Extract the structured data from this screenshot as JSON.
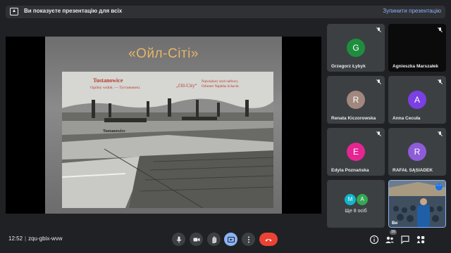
{
  "banner": {
    "message": "Ви показуєте презентацію для всіх",
    "stop_label": "Зупинити презентацію"
  },
  "slide": {
    "title": "«Ойл-Сіті»",
    "photo": {
      "caption_title": "Tustanowice",
      "caption_sub": "Ogólny widok. — Тустановичі.",
      "caption_mid": "„Oil-City“",
      "caption_right_1": "Największy szyb naftowy.",
      "caption_right_2": "Orbester Naphtha Schacht.",
      "caption_label": "Tustanowice"
    }
  },
  "participants": [
    {
      "name": "Grzegorz Łybyk",
      "initial": "G",
      "color": "#1e8e3e",
      "muted": true
    },
    {
      "name": "Agnieszka Marszałek",
      "initial": "",
      "color": "#000000",
      "muted": true,
      "video_dark": true
    },
    {
      "name": "Renata Kiczorowska",
      "initial": "R",
      "color": "#a1887f",
      "muted": true
    },
    {
      "name": "Anna Cecuła",
      "initial": "A",
      "color": "#7b3fe4",
      "muted": true
    },
    {
      "name": "Edyta Poznańska",
      "initial": "E",
      "color": "#e52592",
      "muted": true
    },
    {
      "name": "RAFAŁ SĄSIADEK",
      "initial": "R",
      "color": "#8e5cd9",
      "muted": true
    }
  ],
  "more_tile": {
    "label": "Ще 8 осіб",
    "avatars": [
      {
        "initial": "M",
        "color": "#12b5cb"
      },
      {
        "initial": "A",
        "color": "#34a853"
      }
    ]
  },
  "self_tile": {
    "name": "Ви",
    "menu_icon": "more-dots-icon"
  },
  "bottom": {
    "time": "12:52",
    "separator": "|",
    "meeting_code": "zqu-gbix-wvw",
    "controls": [
      "mic-icon",
      "camera-icon",
      "raise-hand-icon",
      "present-icon",
      "more-vert-icon",
      "hangup-icon"
    ],
    "right_controls": [
      "info-icon",
      "people-icon",
      "chat-icon",
      "activities-icon"
    ],
    "people_count": "16"
  },
  "colors": {
    "accent": "#8ab4f8",
    "hangup": "#ea4335",
    "surface": "#3c4043",
    "background": "#202124"
  }
}
